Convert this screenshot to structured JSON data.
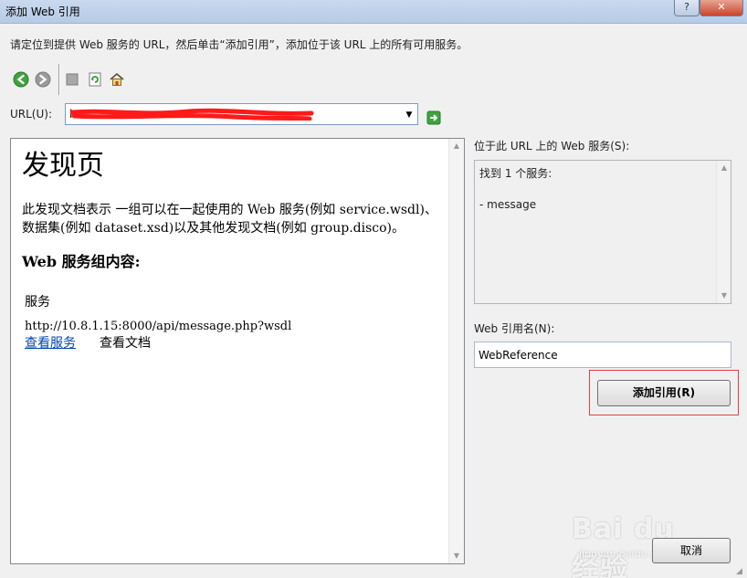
{
  "window": {
    "title": "添加 Web 引用",
    "help_label": "?",
    "close_label": "✕"
  },
  "instruction": "请定位到提供 Web 服务的 URL，然后单击“添加引用”，添加位于该 URL 上的所有可用服务。",
  "toolbar": {
    "icons": [
      "back-icon",
      "forward-icon",
      "stop-icon",
      "refresh-icon",
      "home-icon"
    ]
  },
  "url": {
    "label": "URL(U):",
    "value": "h"
  },
  "browser": {
    "title": "发现页",
    "description": "此发现文档表示 一组可以在一起使用的 Web 服务(例如 service.wsdl)、 数据集(例如 dataset.xsd)以及其他发现文档(例如 group.disco)。",
    "section_heading": "Web 服务组内容:",
    "service_column": "服务",
    "service_url": "http://10.8.1.15:8000/api/message.php?wsdl",
    "view_service_link": "查看服务",
    "view_doc_text": "查看文档"
  },
  "services_panel": {
    "label": "位于此 URL 上的 Web 服务(S):",
    "found": "找到 1 个服务:",
    "item": "- message"
  },
  "reference": {
    "label": "Web 引用名(N):",
    "value": "WebReference"
  },
  "buttons": {
    "add_reference": "添加引用(R)",
    "cancel": "取消"
  },
  "watermark": {
    "brand": "Bai du 经验",
    "sub": "jingyan.baidu.com"
  },
  "colors": {
    "titlebar": "#b7cbe6",
    "close_button": "#c7452b",
    "link": "#0645ad",
    "highlight_border": "#e04040",
    "redaction": "#ff1a1a"
  }
}
